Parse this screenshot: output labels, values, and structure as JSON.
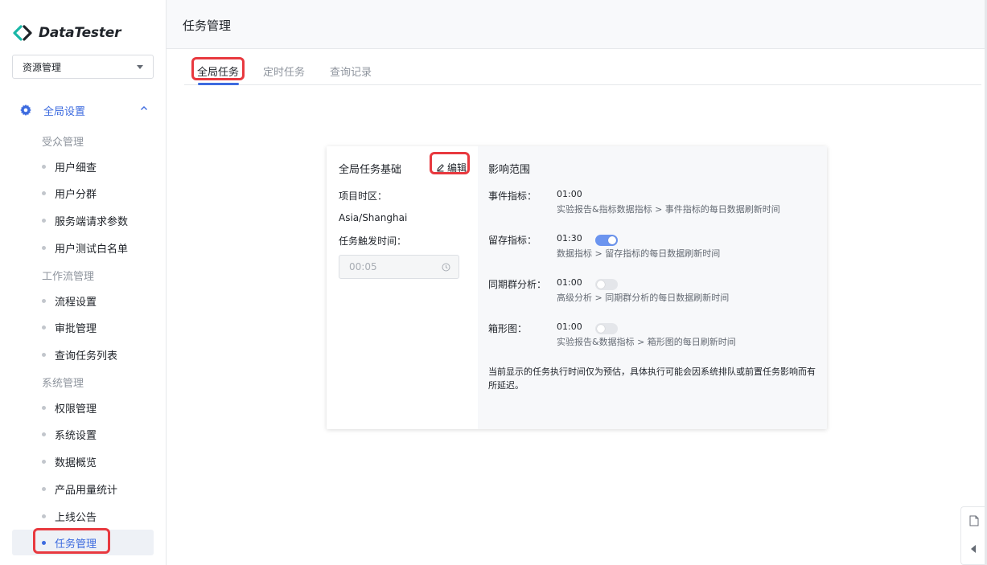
{
  "app": {
    "logo_text": "DataTester",
    "project_select": "资源管理",
    "page_title": "任务管理"
  },
  "sidebar": {
    "group_label": "全局设置",
    "sections": [
      {
        "title": "受众管理",
        "items": [
          "用户细查",
          "用户分群",
          "服务端请求参数",
          "用户测试白名单"
        ]
      },
      {
        "title": "工作流管理",
        "items": [
          "流程设置",
          "审批管理",
          "查询任务列表"
        ]
      },
      {
        "title": "系统管理",
        "items": [
          "权限管理",
          "系统设置",
          "数据概览",
          "产品用量统计",
          "上线公告",
          "任务管理"
        ]
      }
    ],
    "active_item": "任务管理"
  },
  "tabs": [
    "全局任务",
    "定时任务",
    "查询记录"
  ],
  "active_tab": "全局任务",
  "card": {
    "left_title": "全局任务基础",
    "edit_label": "编辑",
    "timezone_label": "项目时区：",
    "timezone_value": "Asia/Shanghai",
    "trigger_label": "任务触发时间：",
    "trigger_value": "00:05",
    "right_title": "影响范围",
    "metrics": [
      {
        "name": "事件指标：",
        "time": "01:00",
        "path": "实验报告&指标数据指标 > 事件指标的每日数据刷新时间",
        "has_switch": false,
        "switch_on": false
      },
      {
        "name": "留存指标：",
        "time": "01:30",
        "path": "数据指标 > 留存指标的每日数据刷新时间",
        "has_switch": true,
        "switch_on": true
      },
      {
        "name": "同期群分析：",
        "time": "01:00",
        "path": "高级分析 > 同期群分析的每日数据刷新时间",
        "has_switch": true,
        "switch_on": false
      },
      {
        "name": "箱形图：",
        "time": "01:00",
        "path": "实验报告&数据指标 > 箱形图的每日刷新时间",
        "has_switch": true,
        "switch_on": false
      }
    ],
    "note": "当前显示的任务执行时间仅为预估，具体执行可能会因系统排队或前置任务影响而有所延迟。"
  },
  "colors": {
    "accent": "#3d6bdf",
    "highlight": "#e8393f",
    "switch_on": "#6b94ef"
  }
}
